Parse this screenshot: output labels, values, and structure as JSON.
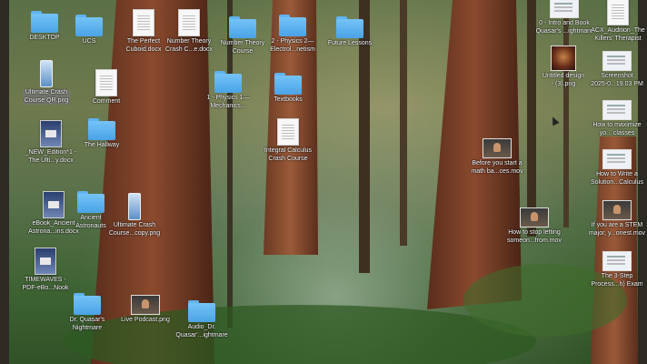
{
  "desktop": {
    "items": [
      {
        "name": "desktop-folder",
        "type": "folder",
        "label": "DESKTOP"
      },
      {
        "name": "ucs-folder",
        "type": "folder",
        "label": "UCS"
      },
      {
        "name": "perfect-cuboid-doc",
        "type": "doc",
        "label": "The Perfect\nCuboid.docx"
      },
      {
        "name": "number-theory-doc",
        "type": "doc",
        "label": "Number Theory\nCrash C...e.docx"
      },
      {
        "name": "number-theory-course-folder",
        "type": "folder",
        "label": "Number Theory\nCourse"
      },
      {
        "name": "physics-2-folder",
        "type": "folder",
        "label": "2 - Physics 2—\nElectrol...netism"
      },
      {
        "name": "future-lessons-folder",
        "type": "folder",
        "label": "Future Lessons"
      },
      {
        "name": "intro-book-file",
        "type": "shot-light",
        "label": "0 - Intro and Book\nQuasar's ...ightmare"
      },
      {
        "name": "acx-audition-file",
        "type": "doc",
        "label": "ACX_Audition_The\nKillers' Therapist"
      },
      {
        "name": "ultimate-crash-qr-file",
        "type": "phone",
        "label": "Ultimate Crash\nCourse QR.png",
        "selected": true
      },
      {
        "name": "comment-doc",
        "type": "doc",
        "label": "Comment"
      },
      {
        "name": "physics-1-folder",
        "type": "folder",
        "label": "1 - Physics 1—\nMechanics..."
      },
      {
        "name": "textbooks-folder",
        "type": "folder",
        "label": "Textbooks"
      },
      {
        "name": "untitled-design-file",
        "type": "pic",
        "label": "Untitled design\n- (3).png"
      },
      {
        "name": "screenshot-file",
        "type": "shot-light",
        "label": "Screenshot\n2025-0...19.03 PM"
      },
      {
        "name": "new-edition-doc",
        "type": "cover",
        "label": "_NEW_Edition*1 -\nThe Ulti...y.docx"
      },
      {
        "name": "hallway-folder",
        "type": "folder",
        "label": "The Hallway"
      },
      {
        "name": "integral-calculus-doc",
        "type": "doc",
        "label": "Integral Calculus\nCrash Course"
      },
      {
        "name": "before-math-video",
        "type": "shot-person",
        "label": "Before you start a\nmath ba...ces.mov"
      },
      {
        "name": "maximize-classes-file",
        "type": "shot-light",
        "label": "How to maximize\nyo... classes"
      },
      {
        "name": "write-solution-file",
        "type": "shot-light",
        "label": "How to Write a\nSolution...Calculus"
      },
      {
        "name": "ebook-ancient-doc",
        "type": "cover",
        "label": "eBook_Ancient\nAstrona...ins.docx"
      },
      {
        "name": "ancient-astronauts-folder",
        "type": "folder",
        "label": "Ancient\nAstronauts"
      },
      {
        "name": "ultimate-crash-copy-file",
        "type": "phone",
        "label": "Ultimate Crash\nCourse...copy.png"
      },
      {
        "name": "stop-letting-video",
        "type": "shot-person",
        "label": "How to stop letting\nsomeon...from.mov"
      },
      {
        "name": "stem-major-video",
        "type": "shot-person",
        "label": "If you are a STEM\nmajor, y...onest.mov"
      },
      {
        "name": "timewaves-doc",
        "type": "cover",
        "label": "TIMEWAVES -\nPDF-eBo...Nook"
      },
      {
        "name": "three-step-file",
        "type": "shot-light",
        "label": "The 3-Step\nProcess...h) Exam"
      },
      {
        "name": "quasar-nightmare-folder",
        "type": "folder",
        "label": "Dr. Quasar's\nNightmare"
      },
      {
        "name": "live-podcast-file",
        "type": "shot-person",
        "label": "Live Podcast.png"
      },
      {
        "name": "audio-quasar-folder",
        "type": "folder",
        "label": "Audio_Dr.\nQuasar'...ightmare"
      }
    ]
  }
}
